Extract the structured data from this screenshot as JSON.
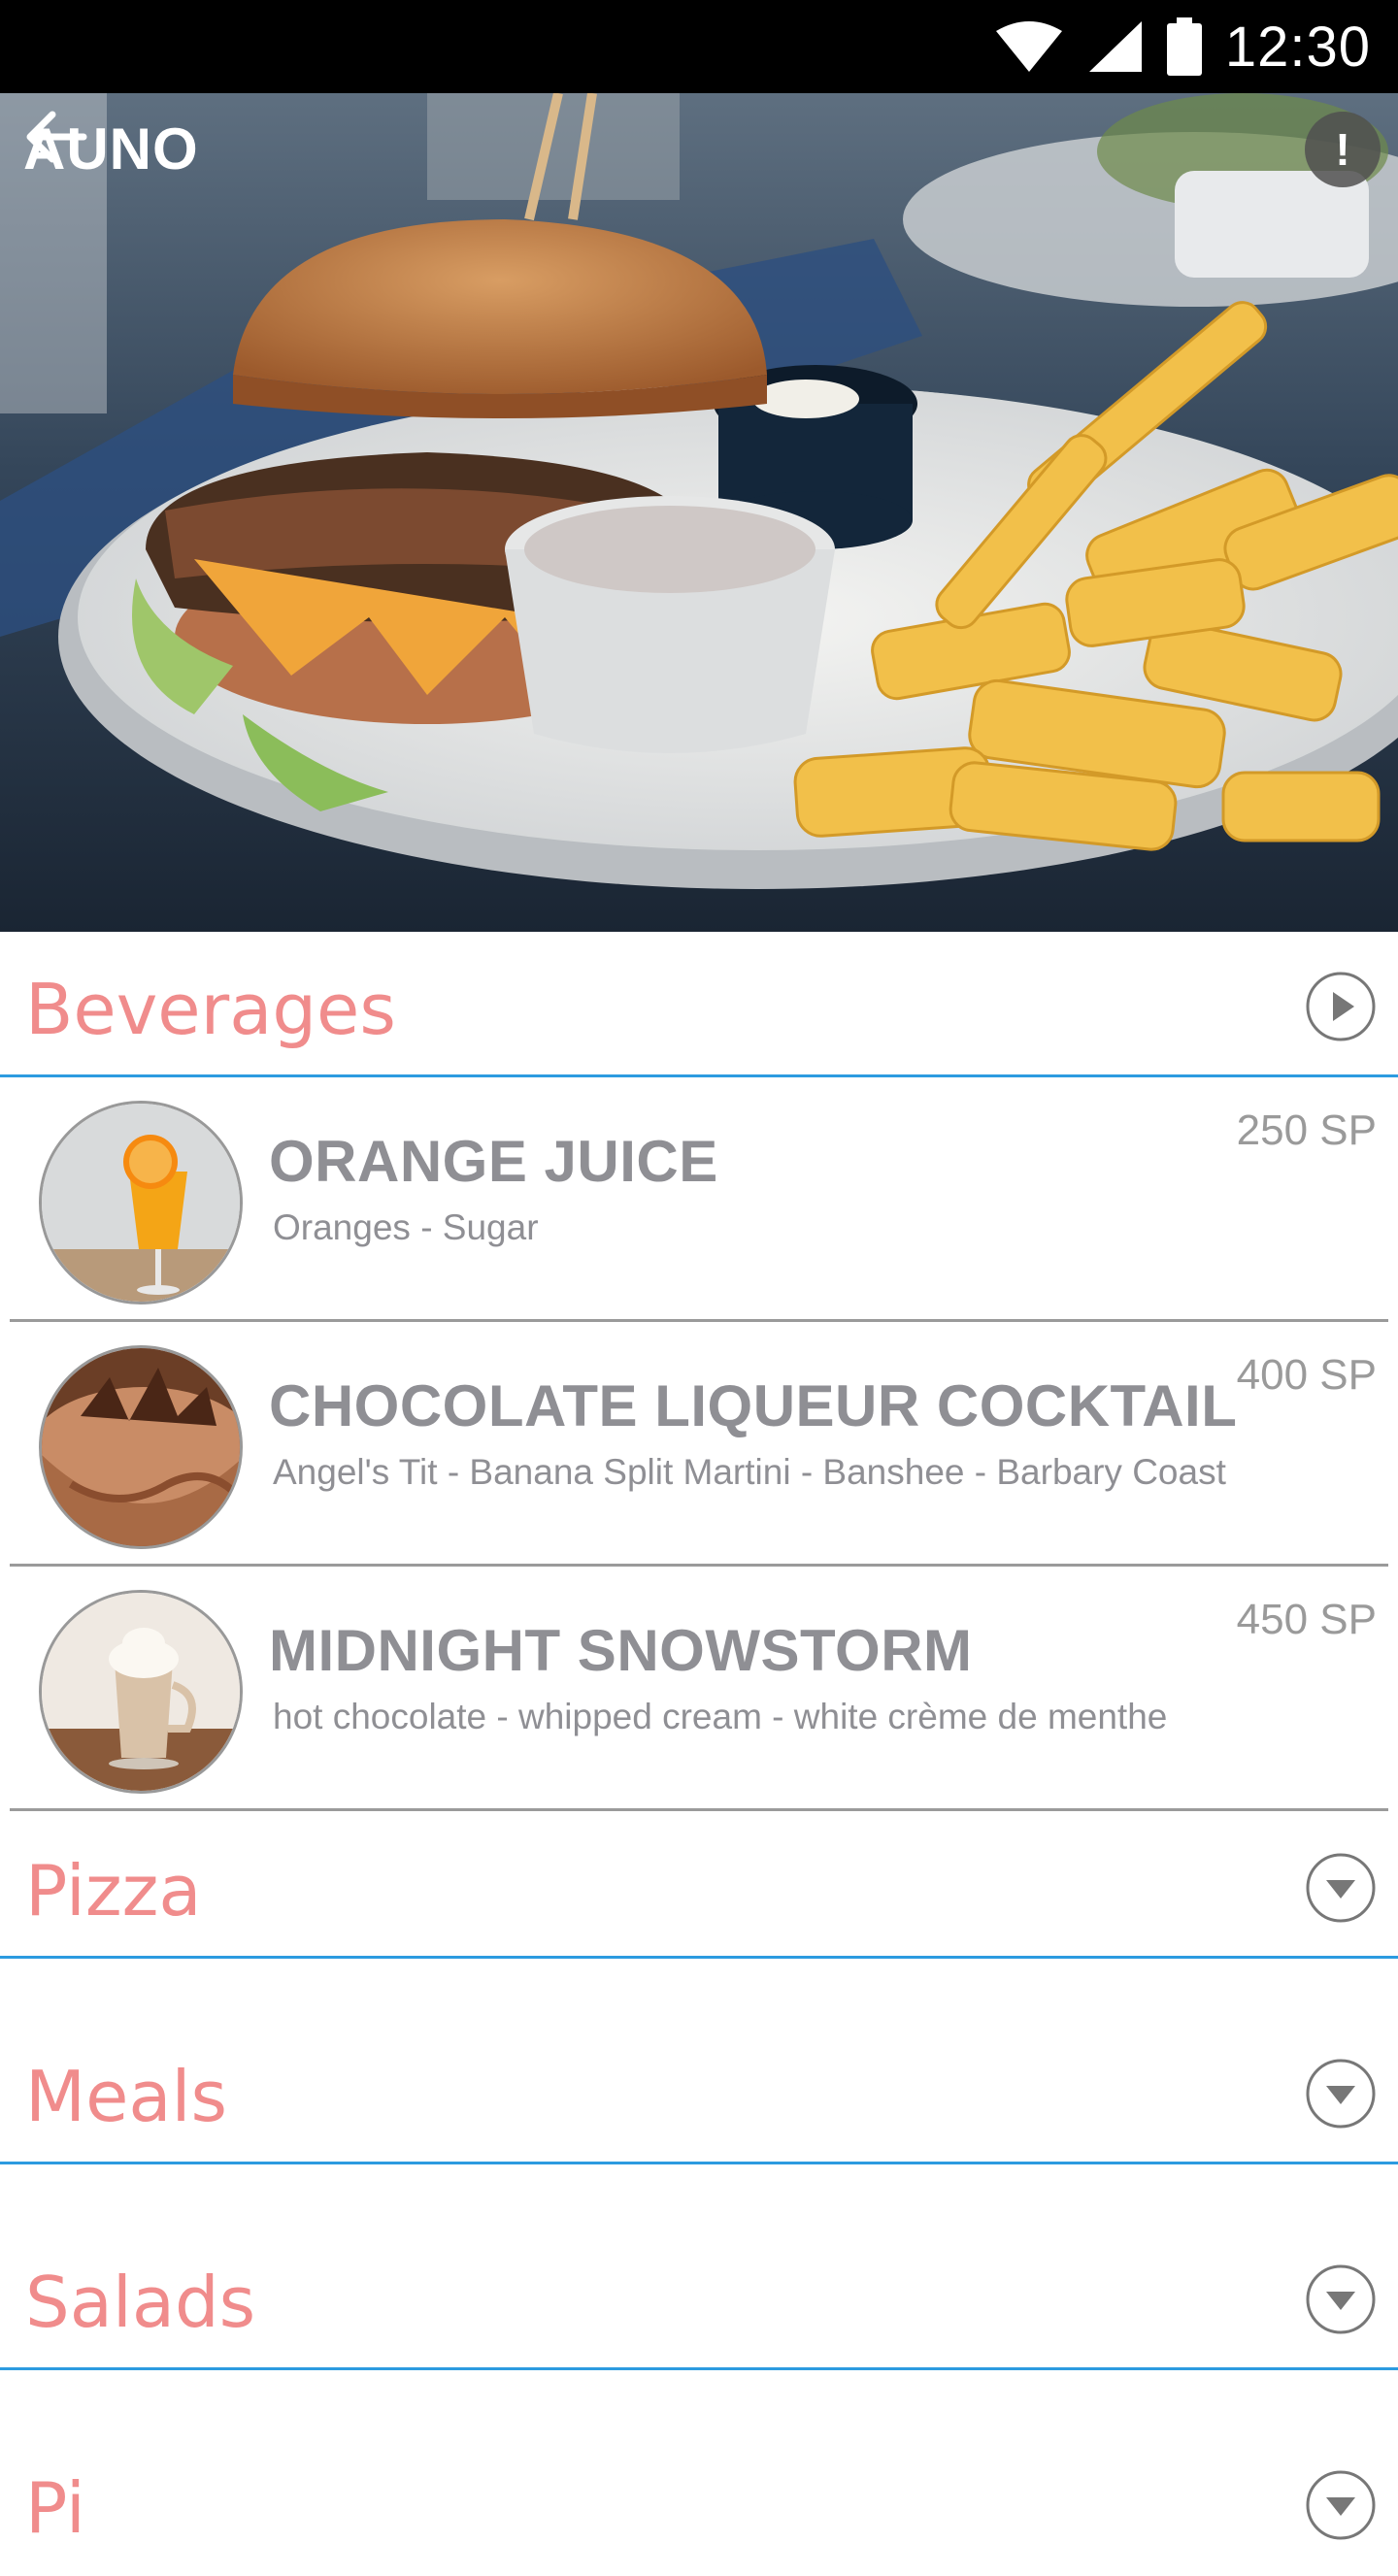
{
  "status_bar": {
    "time": "12:30"
  },
  "header": {
    "title": "AUNO"
  },
  "categories": [
    {
      "title": "Beverages",
      "expanded": true
    },
    {
      "title": "Pizza",
      "expanded": false
    },
    {
      "title": "Meals",
      "expanded": false
    },
    {
      "title": "Salads",
      "expanded": false
    },
    {
      "title": "Pi",
      "expanded": false
    }
  ],
  "items": [
    {
      "name": "ORANGE JUICE",
      "description": "Oranges - Sugar",
      "price": "250 SP"
    },
    {
      "name": "CHOCOLATE LIQUEUR COCKTAIL",
      "description": "Angel's Tit - Banana Split Martini - Banshee - Barbary Coast",
      "price": "400 SP"
    },
    {
      "name": "MIDNIGHT SNOWSTORM",
      "description": "hot chocolate - whipped cream - white crème de menthe",
      "price": "450 SP"
    }
  ],
  "colors": {
    "category_text": "#f08c8c",
    "category_line": "#2c9be0",
    "item_text": "#8f8f94"
  },
  "icons": [
    "wifi-icon",
    "signal-icon",
    "battery-icon",
    "back-arrow-icon",
    "info-icon",
    "chevron-right-circle-icon",
    "chevron-down-circle-icon"
  ]
}
